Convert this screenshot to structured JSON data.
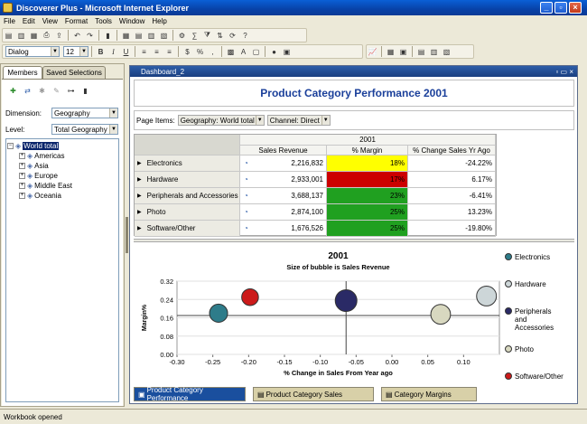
{
  "window": {
    "title": "Discoverer Plus - Microsoft Internet Explorer"
  },
  "menu": [
    "File",
    "Edit",
    "View",
    "Format",
    "Tools",
    "Window",
    "Help"
  ],
  "format_bar": {
    "font": "Dialog",
    "size": "12"
  },
  "left_panel": {
    "tabs": [
      "Members",
      "Saved Selections"
    ],
    "dimension_label": "Dimension:",
    "dimension_value": "Geography",
    "level_label": "Level:",
    "level_value": "Total Geography",
    "tree_root": "World total",
    "tree_children": [
      "Americas",
      "Asia",
      "Europe",
      "Middle East",
      "Oceania"
    ]
  },
  "dashboard": {
    "window_title": "Dashboard_2",
    "title": "Product Category Performance 2001",
    "page_items_label": "Page Items:",
    "page_items": [
      "Geography: World total",
      "Channel: Direct"
    ],
    "year_header": "2001",
    "columns": [
      "Sales Revenue",
      "% Margin",
      "% Change Sales Yr Ago"
    ],
    "rows": [
      {
        "name": "Electronics",
        "revenue": "2,216,832",
        "margin": "18%",
        "change": "-24.22%",
        "color": "#ffff00"
      },
      {
        "name": "Hardware",
        "revenue": "2,933,001",
        "margin": "17%",
        "change": "6.17%",
        "color": "#cc0000"
      },
      {
        "name": "Peripherals and Accessories",
        "revenue": "3,688,137",
        "margin": "23%",
        "change": "-6.41%",
        "color": "#20a020"
      },
      {
        "name": "Photo",
        "revenue": "2,874,100",
        "margin": "25%",
        "change": "13.23%",
        "color": "#20a020"
      },
      {
        "name": "Software/Other",
        "revenue": "1,676,526",
        "margin": "25%",
        "change": "-19.80%",
        "color": "#20a020"
      }
    ],
    "bottom_tabs": [
      "Product Category Performance",
      "Product Category Sales",
      "Category Margins"
    ]
  },
  "chart_data": {
    "type": "scatter",
    "title": "2001",
    "subtitle": "Size of bubble is Sales Revenue",
    "xlabel": "% Change in Sales From Year ago",
    "ylabel": "Margin%",
    "xlim": [
      -0.3,
      0.15
    ],
    "ylim": [
      0.0,
      0.32
    ],
    "xticks": [
      "-0.30",
      "-0.25",
      "-0.20",
      "-0.15",
      "-0.10",
      "-0.05",
      "0.00",
      "0.05",
      "0.10"
    ],
    "yticks": [
      "0.00",
      "0.08",
      "0.16",
      "0.24",
      "0.32"
    ],
    "series": [
      {
        "name": "Electronics",
        "x": -0.242,
        "y": 0.18,
        "size": 2216832,
        "color": "#2e7c8a"
      },
      {
        "name": "Hardware",
        "x": 0.132,
        "y": 0.255,
        "size": 2933001,
        "color": "#cdd6d8"
      },
      {
        "name": "Peripherals and Accessories",
        "x": -0.064,
        "y": 0.235,
        "size": 3688137,
        "color": "#2a2a66"
      },
      {
        "name": "Photo",
        "x": 0.068,
        "y": 0.175,
        "size": 2874100,
        "color": "#d8d8c0"
      },
      {
        "name": "Software/Other",
        "x": -0.198,
        "y": 0.25,
        "size": 1676526,
        "color": "#cc1a1a"
      }
    ],
    "crosshair": {
      "x": -0.064,
      "y": 0.17
    }
  },
  "status": "Workbook opened"
}
